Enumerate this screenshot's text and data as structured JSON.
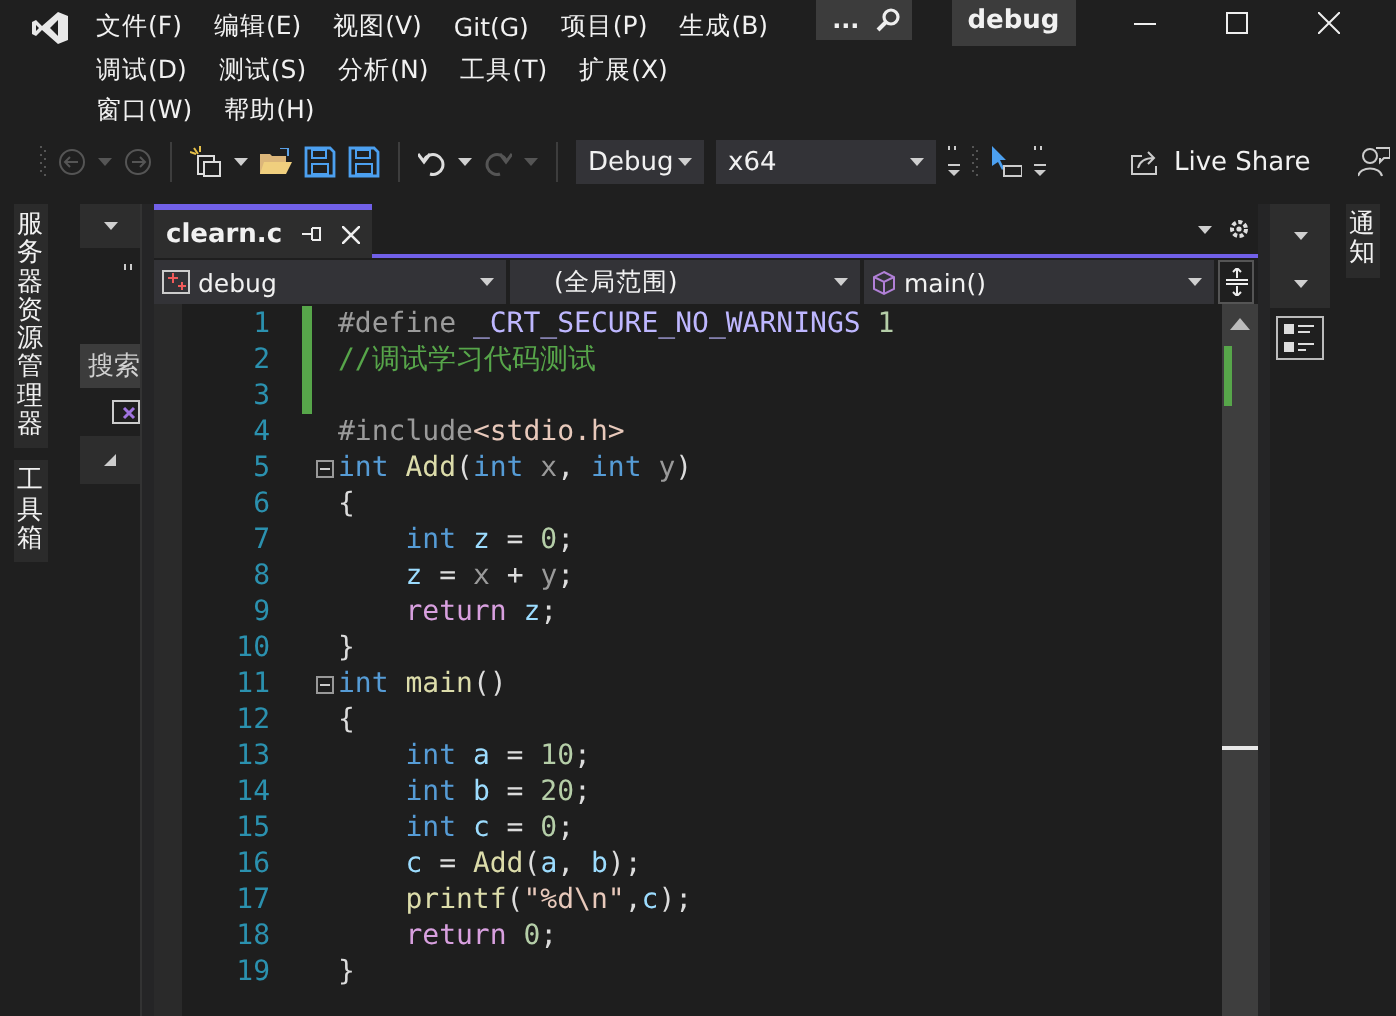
{
  "window": {
    "title": "debug"
  },
  "menu_rows": [
    [
      "文件(F)",
      "编辑(E)",
      "视图(V)",
      "Git(G)",
      "项目(P)",
      "生成(B)"
    ],
    [
      "调试(D)",
      "测试(S)",
      "分析(N)",
      "工具(T)",
      "扩展(X)"
    ],
    [
      "窗口(W)",
      "帮助(H)"
    ]
  ],
  "search": {
    "label": "..."
  },
  "toolbar": {
    "configuration": "Debug",
    "platform": "x64",
    "live_share": "Live Share",
    "back_disabled": true,
    "forward_disabled": true,
    "redo_disabled": true
  },
  "left_tabs": [
    "服务器资源管理器",
    "工具箱"
  ],
  "side_panel": {
    "search_label": "搜索"
  },
  "editor_tabs": [
    {
      "label": "clearn.c",
      "selected": true
    }
  ],
  "nav_bar": {
    "project": "debug",
    "scope": "(全局范围)",
    "member": "main()"
  },
  "code_lines": [
    {
      "number": "1",
      "changed": true,
      "fold_box": false,
      "tokens": [
        {
          "t": "#define",
          "kind": "pp"
        },
        {
          "t": " _CRT_SECURE_NO_WARNINGS",
          "kind": "macro"
        },
        {
          "t": " 1",
          "kind": "num"
        }
      ]
    },
    {
      "number": "2",
      "changed": true,
      "fold_box": false,
      "tokens": [
        {
          "t": "//调试学习代码测试",
          "kind": "cmt"
        }
      ]
    },
    {
      "number": "3",
      "changed": true,
      "fold_box": false
    },
    {
      "number": "4",
      "changed": false,
      "fold_box": false,
      "tokens": [
        {
          "t": "#include",
          "kind": "pp"
        },
        {
          "t": "<stdio.h>",
          "kind": "str"
        }
      ]
    },
    {
      "number": "5",
      "changed": false,
      "fold_box": true,
      "tokens": [
        {
          "t": "int",
          "kind": "kw"
        },
        {
          "t": " Add",
          "kind": "fn"
        },
        {
          "t": "(",
          "kind": "punct"
        },
        {
          "t": "int",
          "kind": "kw"
        },
        {
          "t": " x",
          "kind": "param"
        },
        {
          "t": ", ",
          "kind": "punct"
        },
        {
          "t": "int",
          "kind": "kw"
        },
        {
          "t": " y",
          "kind": "param"
        },
        {
          "t": ")",
          "kind": "punct"
        }
      ]
    },
    {
      "number": "6",
      "changed": false,
      "fold_box": false,
      "tokens": [
        {
          "t": "{",
          "kind": "punct"
        }
      ]
    },
    {
      "number": "7",
      "changed": false,
      "fold_box": false,
      "tokens": [
        {
          "t": "    int",
          "kind": "kw"
        },
        {
          "t": " z",
          "kind": "var"
        },
        {
          "t": " = ",
          "kind": "punct"
        },
        {
          "t": "0",
          "kind": "num"
        },
        {
          "t": ";",
          "kind": "punct"
        }
      ]
    },
    {
      "number": "8",
      "changed": false,
      "fold_box": false,
      "tokens": [
        {
          "t": "    z",
          "kind": "var"
        },
        {
          "t": " = ",
          "kind": "punct"
        },
        {
          "t": "x",
          "kind": "param"
        },
        {
          "t": " + ",
          "kind": "punct"
        },
        {
          "t": "y",
          "kind": "param"
        },
        {
          "t": ";",
          "kind": "punct"
        }
      ]
    },
    {
      "number": "9",
      "changed": false,
      "fold_box": false,
      "tokens": [
        {
          "t": "    return",
          "kind": "ctrl"
        },
        {
          "t": " z",
          "kind": "var"
        },
        {
          "t": ";",
          "kind": "punct"
        }
      ]
    },
    {
      "number": "10",
      "changed": false,
      "fold_box": false,
      "tokens": [
        {
          "t": "}",
          "kind": "punct"
        }
      ]
    },
    {
      "number": "11",
      "changed": false,
      "fold_box": true,
      "tokens": [
        {
          "t": "int",
          "kind": "kw"
        },
        {
          "t": " main",
          "kind": "fn"
        },
        {
          "t": "()",
          "kind": "punct"
        }
      ]
    },
    {
      "number": "12",
      "changed": false,
      "fold_box": false,
      "tokens": [
        {
          "t": "{",
          "kind": "punct"
        }
      ]
    },
    {
      "number": "13",
      "changed": false,
      "fold_box": false,
      "tokens": [
        {
          "t": "    int",
          "kind": "kw"
        },
        {
          "t": " a",
          "kind": "var"
        },
        {
          "t": " = ",
          "kind": "punct"
        },
        {
          "t": "10",
          "kind": "num"
        },
        {
          "t": ";",
          "kind": "punct"
        }
      ]
    },
    {
      "number": "14",
      "changed": false,
      "fold_box": false,
      "tokens": [
        {
          "t": "    int",
          "kind": "kw"
        },
        {
          "t": " b",
          "kind": "var"
        },
        {
          "t": " = ",
          "kind": "punct"
        },
        {
          "t": "20",
          "kind": "num"
        },
        {
          "t": ";",
          "kind": "punct"
        }
      ]
    },
    {
      "number": "15",
      "changed": false,
      "fold_box": false,
      "tokens": [
        {
          "t": "    int",
          "kind": "kw"
        },
        {
          "t": " c",
          "kind": "var"
        },
        {
          "t": " = ",
          "kind": "punct"
        },
        {
          "t": "0",
          "kind": "num"
        },
        {
          "t": ";",
          "kind": "punct"
        }
      ]
    },
    {
      "number": "16",
      "changed": false,
      "fold_box": false,
      "tokens": [
        {
          "t": "    c",
          "kind": "var"
        },
        {
          "t": " = ",
          "kind": "punct"
        },
        {
          "t": "Add",
          "kind": "fn"
        },
        {
          "t": "(",
          "kind": "punct"
        },
        {
          "t": "a",
          "kind": "var"
        },
        {
          "t": ", ",
          "kind": "punct"
        },
        {
          "t": "b",
          "kind": "var"
        },
        {
          "t": ");",
          "kind": "punct"
        }
      ]
    },
    {
      "number": "17",
      "changed": false,
      "fold_box": false,
      "tokens": [
        {
          "t": "    printf",
          "kind": "fn"
        },
        {
          "t": "(",
          "kind": "punct"
        },
        {
          "t": "\"%d\\n\"",
          "kind": "str"
        },
        {
          "t": ",",
          "kind": "punct"
        },
        {
          "t": "c",
          "kind": "var"
        },
        {
          "t": ");",
          "kind": "punct"
        }
      ]
    },
    {
      "number": "18",
      "changed": false,
      "fold_box": false,
      "tokens": [
        {
          "t": "    return",
          "kind": "ctrl"
        },
        {
          "t": " 0",
          "kind": "num"
        },
        {
          "t": ";",
          "kind": "punct"
        }
      ]
    },
    {
      "number": "19",
      "changed": false,
      "fold_box": false,
      "tokens": [
        {
          "t": "}",
          "kind": "punct"
        }
      ]
    }
  ],
  "right_tabs": [
    "通知"
  ]
}
